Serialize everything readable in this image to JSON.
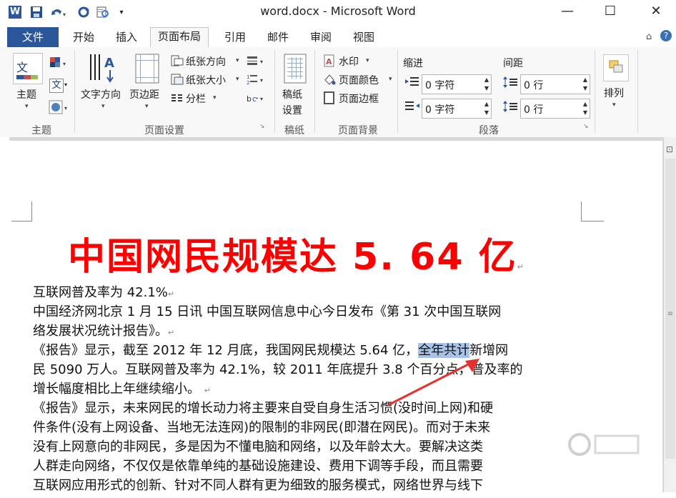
{
  "window": {
    "title": "word.docx - Microsoft Word"
  },
  "qat": {
    "word_icon": "W"
  },
  "tabs": [
    {
      "label": "文件"
    },
    {
      "label": "开始"
    },
    {
      "label": "插入"
    },
    {
      "label": "页面布局"
    },
    {
      "label": "引用"
    },
    {
      "label": "邮件"
    },
    {
      "label": "审阅"
    },
    {
      "label": "视图"
    }
  ],
  "ribbon": {
    "theme": {
      "label": "主题",
      "text_icon": "文",
      "group": "主题"
    },
    "page_setup": {
      "text_direction": "文字方向",
      "margins": "页边距",
      "orientation": "纸张方向",
      "size": "纸张大小",
      "columns": "分栏",
      "group": "页面设置"
    },
    "draft": {
      "label1": "稿纸",
      "label2": "设置",
      "group": "稿纸"
    },
    "background": {
      "watermark": "水印",
      "page_color": "页面颜色",
      "page_border": "页面边框",
      "group": "页面背景"
    },
    "paragraph": {
      "indent": "缩进",
      "spacing": "间距",
      "indent_left": "0 字符",
      "indent_right": "0 字符",
      "space_before": "0 行",
      "space_after": "0 行",
      "group": "段落"
    },
    "arrange": {
      "label": "排列"
    }
  },
  "document": {
    "title": "中国网民规模达 5. 64 亿",
    "lines": [
      "互联网普及率为 42.1%",
      "中国经济网北京 1 月 15 日讯  中国互联网信息中心今日发布《第 31 次中国互联网",
      "络发展状况统计报告》。",
      "《报告》显示，截至 2012 年 12 月底，我国网民规模达 5.64 亿，",
      "全年共计",
      "新增网",
      "民 5090 万人。互联网普及率为 42.1%，较 2011 年底提升 3.8 个百分点，普及率的",
      "增长幅度相比上年继续缩小。",
      "《报告》显示，未来网民的增长动力将主要来自受自身生活习惯(没时间上网)和硬",
      "件条件(没有上网设备、当地无法连网)的限制的非网民(即潜在网民)。而对于未来",
      "没有上网意向的非网民，多是因为不懂电脑和网络，以及年龄太大。要解决这类",
      "人群走向网络，不仅仅是依靠单纯的基础设施建设、费用下调等手段，而且需要",
      "互联网应用形式的创新、针对不同人群有更为细致的服务模式，网络世界与线下"
    ],
    "paragraph_mark": "↵"
  },
  "colors": {
    "file_tab": "#2b579a",
    "title_red": "#ff0000",
    "highlight": "#a7c4e8",
    "arrow": "#e83030"
  }
}
